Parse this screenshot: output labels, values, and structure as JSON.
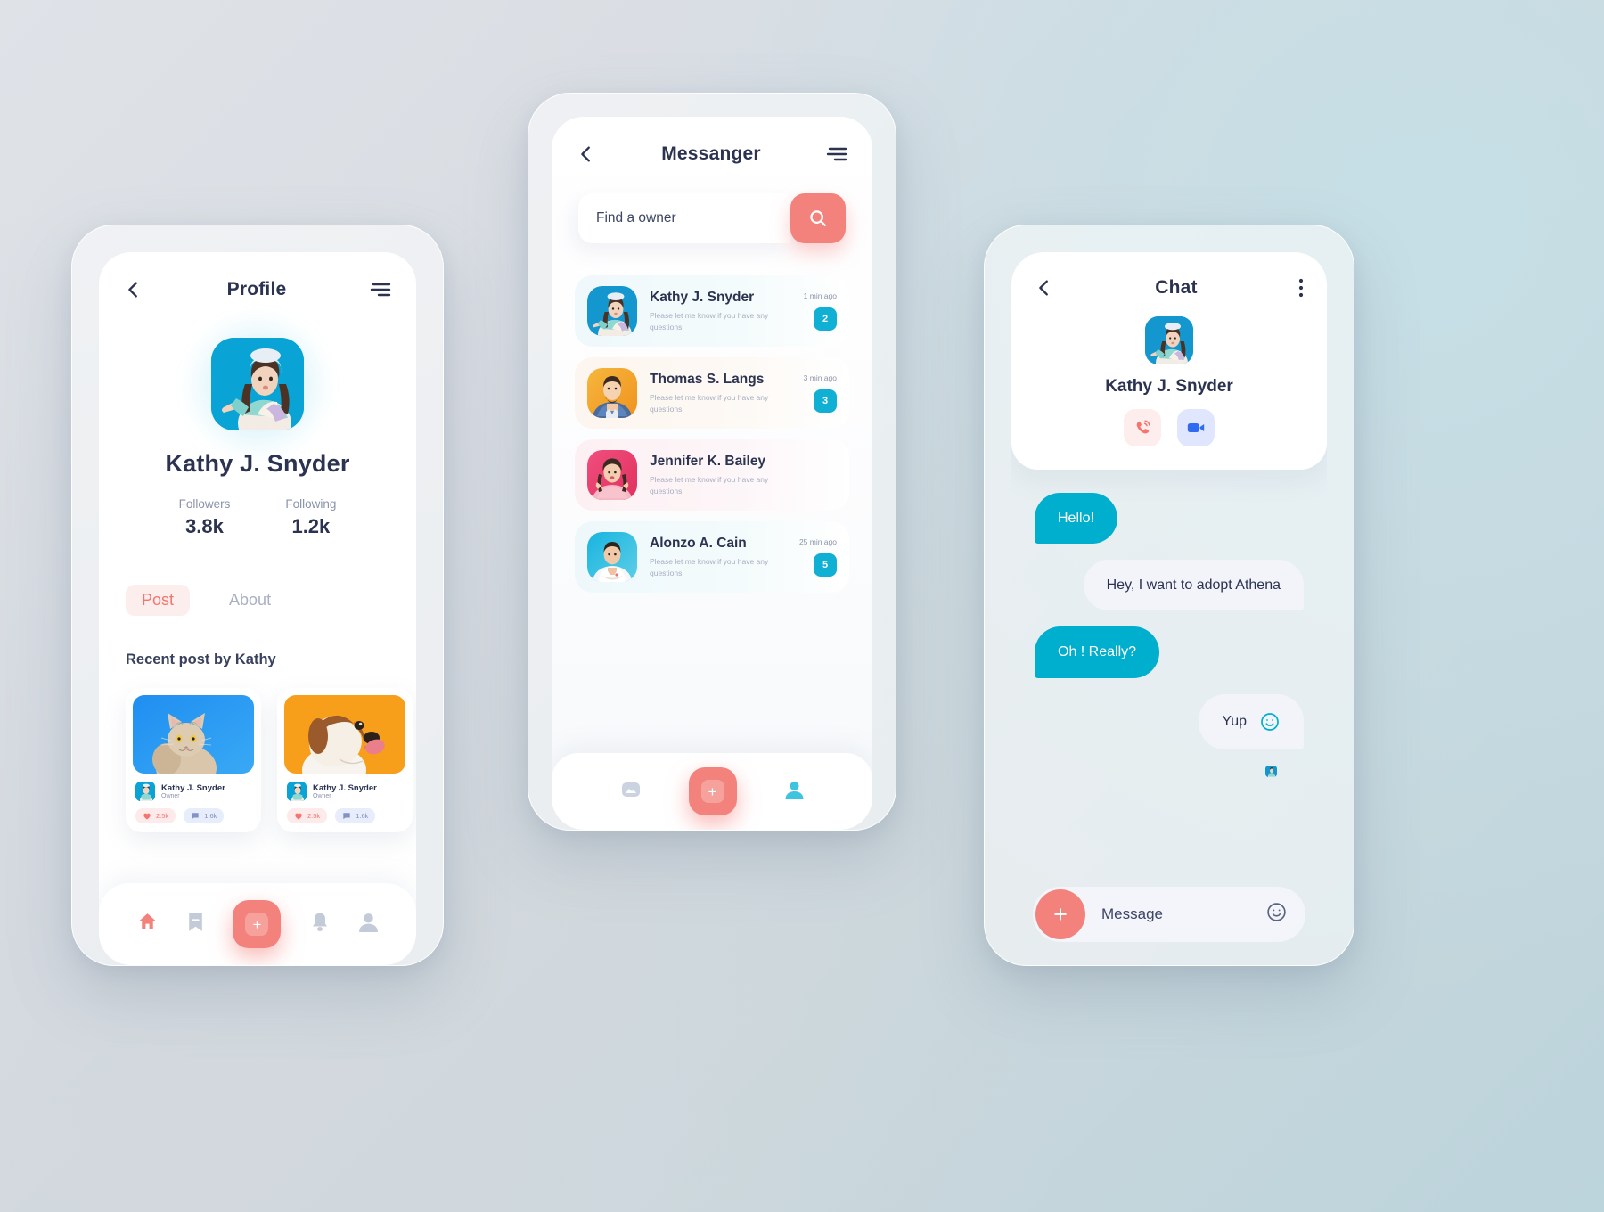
{
  "theme": {
    "accent_coral": "#f4827c",
    "accent_cyan": "#00aecd",
    "badge_cyan": "#10b0d4",
    "text_dark": "#2b3350",
    "text_muted": "#8b93ab"
  },
  "profile_screen": {
    "header": {
      "title": "Profile",
      "back_icon": "chevron-left-icon",
      "menu_icon": "filter-lines-icon"
    },
    "avatar_alt": "woman-pointing-avatar",
    "name": "Kathy J. Snyder",
    "stats": [
      {
        "label": "Followers",
        "value": "3.8k"
      },
      {
        "label": "Following",
        "value": "1.2k"
      }
    ],
    "tabs": [
      {
        "label": "Post",
        "active": true
      },
      {
        "label": "About",
        "active": false
      }
    ],
    "recent_title": "Recent post by Kathy",
    "posts": [
      {
        "thumb": "cat-photo",
        "author": "Kathy J. Snyder",
        "role": "Owner",
        "likes": "2.5k",
        "comments": "1.6k"
      },
      {
        "thumb": "dog-photo",
        "author": "Kathy J. Snyder",
        "role": "Owner",
        "likes": "2.5k",
        "comments": "1.6k"
      }
    ],
    "bottom_nav": [
      {
        "icon": "home-icon",
        "active": true
      },
      {
        "icon": "bookmark-icon",
        "active": false
      },
      {
        "icon": "plus-icon",
        "fab": true
      },
      {
        "icon": "bell-icon",
        "active": false
      },
      {
        "icon": "user-icon",
        "active": false
      }
    ]
  },
  "messenger_screen": {
    "header": {
      "title": "Messanger",
      "back_icon": "chevron-left-icon",
      "menu_icon": "filter-lines-icon"
    },
    "search": {
      "value": "Find a owner",
      "placeholder": "Find a owner",
      "button_icon": "search-icon"
    },
    "conversations": [
      {
        "name": "Kathy J. Snyder",
        "preview": "Please let me know if you have any questions.",
        "time": "1 min ago",
        "unread": "2",
        "avatar": "kathy-avatar"
      },
      {
        "name": "Thomas S. Langs",
        "preview": "Please let me know if you have any questions.",
        "time": "3 min ago",
        "unread": "3",
        "avatar": "thomas-avatar"
      },
      {
        "name": "Jennifer K. Bailey",
        "preview": "Please let me know if you have any questions.",
        "time": "",
        "unread": "",
        "avatar": "jennifer-avatar"
      },
      {
        "name": "Alonzo A. Cain",
        "preview": "Please let me know if you have any questions.",
        "time": "25 min ago",
        "unread": "5",
        "avatar": "alonzo-avatar"
      }
    ],
    "bottom_nav": [
      {
        "icon": "image-icon",
        "active": false
      },
      {
        "icon": "plus-icon",
        "fab": true
      },
      {
        "icon": "user-icon",
        "active": true
      }
    ]
  },
  "chat_screen": {
    "header": {
      "title": "Chat",
      "back_icon": "chevron-left-icon",
      "menu_icon": "dots-vertical-icon"
    },
    "contact_name": "Kathy J. Snyder",
    "actions": [
      {
        "icon": "phone-icon",
        "name": "voice-call"
      },
      {
        "icon": "video-icon",
        "name": "video-call"
      }
    ],
    "messages": [
      {
        "text": "Hello!",
        "side": "out"
      },
      {
        "text": "Hey, I want to adopt Athena",
        "side": "in"
      },
      {
        "text": "Oh ! Really?",
        "side": "out"
      },
      {
        "text": "Yup",
        "side": "in",
        "emoji": "smiley-icon"
      }
    ],
    "input": {
      "placeholder": "Message",
      "value": "Message",
      "plus_icon": "plus-icon",
      "emoji_icon": "smiley-icon"
    }
  }
}
